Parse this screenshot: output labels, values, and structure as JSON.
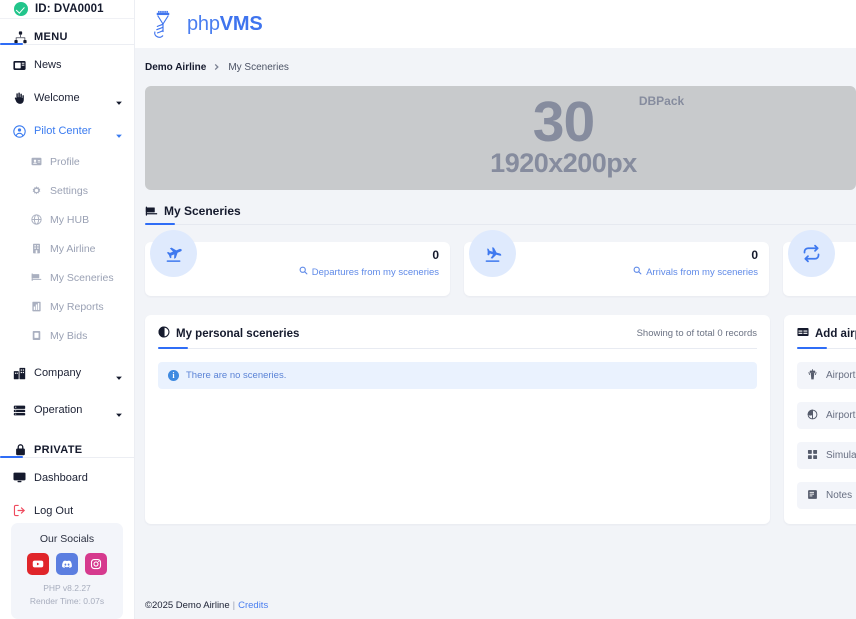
{
  "sidebar": {
    "pilot_id": "ID: DVA0001",
    "sections": [
      {
        "name": "menu",
        "label": "MENU",
        "icon": "sitemap-icon"
      },
      {
        "name": "private",
        "label": "PRIVATE",
        "icon": "lock-icon"
      }
    ],
    "menu_items": [
      {
        "label": "News",
        "icon": "news-icon",
        "sub": false,
        "caret": "none",
        "active": false
      },
      {
        "label": "Welcome",
        "icon": "hand-wave-icon",
        "sub": false,
        "caret": "dark",
        "active": false
      },
      {
        "label": "Pilot Center",
        "icon": "user-circle-icon",
        "sub": false,
        "caret": "blue",
        "active": true
      },
      {
        "label": "Profile",
        "icon": "id-card-icon",
        "sub": true,
        "caret": "none",
        "active": false
      },
      {
        "label": "Settings",
        "icon": "gear-icon",
        "sub": true,
        "caret": "none",
        "active": false
      },
      {
        "label": "My HUB",
        "icon": "globe-icon",
        "sub": true,
        "caret": "none",
        "active": false
      },
      {
        "label": "My Airline",
        "icon": "building-icon",
        "sub": true,
        "caret": "none",
        "active": false
      },
      {
        "label": "My Sceneries",
        "icon": "map-flag-icon",
        "sub": true,
        "caret": "none",
        "active": false
      },
      {
        "label": "My Reports",
        "icon": "chart-bar-icon",
        "sub": true,
        "caret": "none",
        "active": false
      },
      {
        "label": "My Bids",
        "icon": "clipboard-icon",
        "sub": true,
        "caret": "none",
        "active": false
      },
      {
        "label": "Company",
        "icon": "city-icon",
        "sub": false,
        "caret": "dark",
        "active": false
      },
      {
        "label": "Operation",
        "icon": "server-icon",
        "sub": false,
        "caret": "dark",
        "active": false
      }
    ],
    "private_items": [
      {
        "label": "Dashboard",
        "icon": "desktop-icon"
      },
      {
        "label": "Log Out",
        "icon": "logout-icon"
      }
    ],
    "socials": {
      "title": "Our Socials",
      "buttons": [
        {
          "name": "youtube-button",
          "icon": "youtube-icon",
          "color": "#e0252a"
        },
        {
          "name": "discord-button",
          "icon": "discord-icon",
          "color": "#5b7ee0"
        },
        {
          "name": "instagram-button",
          "icon": "instagram-icon",
          "color": "#d63a8e"
        }
      ]
    },
    "php_version": "PHP v8.2.27",
    "render_time": "Render Time: 0.07s"
  },
  "topbar": {
    "brand_php": "php",
    "brand_vms": "VMS",
    "logo_icon": "phpvms-pilot-logo-icon"
  },
  "breadcrumb": {
    "home": "Demo Airline",
    "separator_icon": "chevron-right-icon",
    "current": "My Sceneries"
  },
  "banner": {
    "tag": "DBPack",
    "number": "30",
    "dimensions": "1920x200px"
  },
  "section": {
    "title": "My Sceneries",
    "icon": "map-flag-icon"
  },
  "stats": [
    {
      "name": "departures-stat",
      "icon": "plane-departure-icon",
      "value": "0",
      "label": "Departures from my sceneries",
      "label_icon": "search-icon"
    },
    {
      "name": "arrivals-stat",
      "icon": "plane-arrival-icon",
      "value": "0",
      "label": "Arrivals from my sceneries",
      "label_icon": "search-icon"
    },
    {
      "name": "exchange-stat",
      "icon": "repeat-icon",
      "value": "",
      "label": "",
      "label_icon": "search-icon"
    }
  ],
  "personal_panel": {
    "title": "My personal sceneries",
    "icon": "globe-half-icon",
    "records_text": "Showing to of total 0 records",
    "alert_text": "There are no sceneries.",
    "alert_icon": "info-icon"
  },
  "add_panel": {
    "title": "Add airport",
    "icon": "table-icon",
    "fields": [
      {
        "label": "Airport ICAO",
        "icon": "control-tower-icon"
      },
      {
        "label": "Airport Region",
        "icon": "globe-quarter-icon"
      },
      {
        "label": "Simulator",
        "icon": "grid-icon"
      },
      {
        "label": "Notes",
        "icon": "notes-icon"
      }
    ]
  },
  "footer": {
    "copyright": "©2025 Demo Airline",
    "separator": "|",
    "credits": "Credits"
  },
  "colors": {
    "accent": "#2f6df6",
    "link": "#4a7ef0",
    "muted": "#9aa1b4",
    "page_bg": "#f2f4f8",
    "success": "#22c58b"
  }
}
